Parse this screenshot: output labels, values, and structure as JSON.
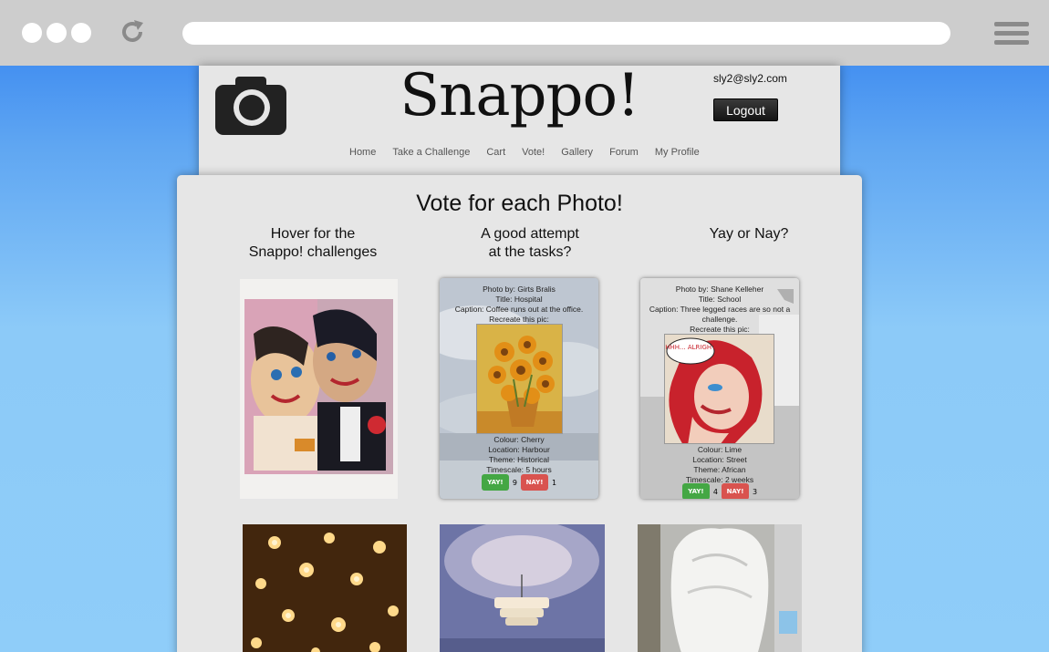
{
  "site": {
    "brand": "Snappo!",
    "user_email": "sly2@sly2.com",
    "logout_label": "Logout",
    "nav": [
      "Home",
      "Take a Challenge",
      "Cart",
      "Vote!",
      "Gallery",
      "Forum",
      "My Profile"
    ]
  },
  "main": {
    "title": "Vote for each Photo!",
    "columns": [
      {
        "line1": "Hover for the",
        "line2": "Snappo! challenges"
      },
      {
        "line1": "A good attempt",
        "line2": "at the tasks?"
      },
      {
        "line1": "Yay or Nay?",
        "line2": ""
      }
    ]
  },
  "cards": [
    {
      "photo_by": "Photo by: Girts Bralis",
      "title": "Title: Hospital",
      "caption": "Caption: Coffee runs out at the office.",
      "recreate": "Recreate this pic:",
      "colour": "Colour: Cherry",
      "location": "Location: Harbour",
      "theme": "Theme: Historical",
      "timescale": "Timescale: 5 hours",
      "yay_label": "YAY!",
      "yay_count": "9",
      "nay_label": "NAY!",
      "nay_count": "1"
    },
    {
      "photo_by": "Photo by: Shane Kelleher",
      "title": "Title: School",
      "caption": "Caption: Three legged races are so not a challenge.",
      "recreate": "Recreate this pic:",
      "colour": "Colour: Lime",
      "location": "Location: Street",
      "theme": "Theme: African",
      "timescale": "Timescale: 2 weeks",
      "yay_label": "YAY!",
      "yay_count": "4",
      "nay_label": "NAY!",
      "nay_count": "3"
    }
  ],
  "comic_text": "OHHH... ALRIGHT...",
  "colors": {
    "yay": "#44a744",
    "nay": "#d9534f",
    "panel": "#e6e6e6"
  }
}
